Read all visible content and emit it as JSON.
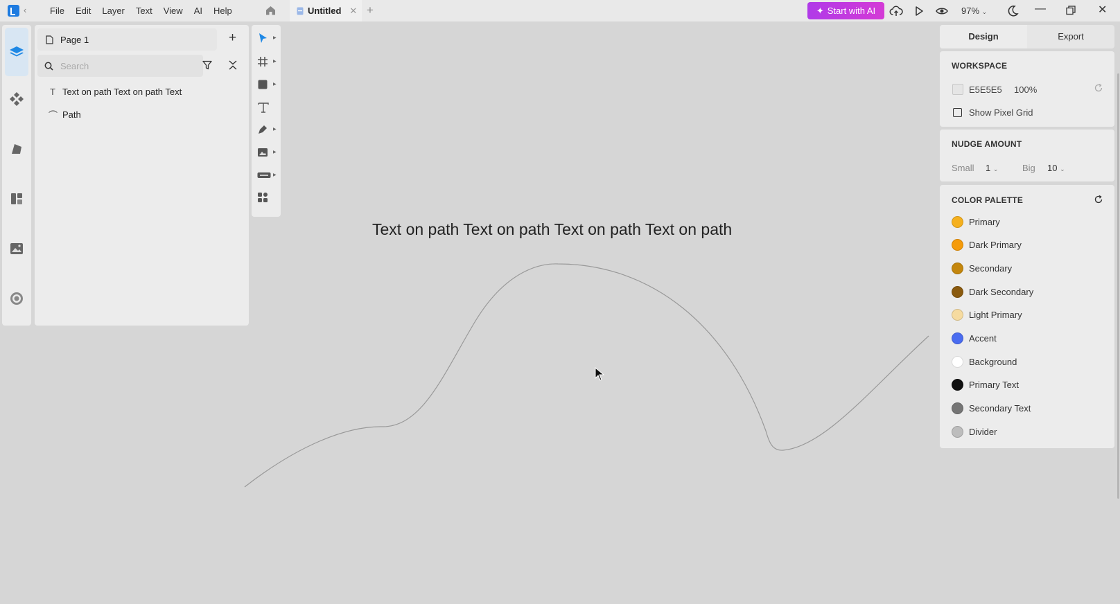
{
  "menu": {
    "items": [
      "File",
      "Edit",
      "Layer",
      "Text",
      "View",
      "AI",
      "Help"
    ]
  },
  "tab": {
    "title": "Untitled"
  },
  "toolbar": {
    "ai_button_label": "Start with AI",
    "zoom": "97%"
  },
  "layers": {
    "page_name": "Page 1",
    "search_placeholder": "Search",
    "items": [
      {
        "type": "text",
        "icon": "text-layer-icon",
        "label": "Text on path Text on path Text"
      },
      {
        "type": "path",
        "icon": "path-layer-icon",
        "label": "Path"
      }
    ]
  },
  "canvas": {
    "text": "Text on path Text on path Text on path Text on path"
  },
  "right_panel": {
    "tabs": [
      "Design",
      "Export"
    ],
    "workspace": {
      "title": "WORKSPACE",
      "color_hex": "E5E5E5",
      "color": "#E5E5E5",
      "opacity": "100%",
      "show_pixel_grid_label": "Show Pixel Grid",
      "show_pixel_grid": false
    },
    "nudge": {
      "title": "NUDGE AMOUNT",
      "small_label": "Small",
      "small_value": "1",
      "big_label": "Big",
      "big_value": "10"
    },
    "palette": {
      "title": "COLOR PALETTE",
      "colors": [
        {
          "name": "Primary",
          "color": "#F5B01E"
        },
        {
          "name": "Dark Primary",
          "color": "#F59B0A"
        },
        {
          "name": "Secondary",
          "color": "#C4860C"
        },
        {
          "name": "Dark Secondary",
          "color": "#8A5A0E"
        },
        {
          "name": "Light Primary",
          "color": "#F6DBA0"
        },
        {
          "name": "Accent",
          "color": "#4A6CF0"
        },
        {
          "name": "Background",
          "color": "#FFFFFF"
        },
        {
          "name": "Primary Text",
          "color": "#111111"
        },
        {
          "name": "Secondary Text",
          "color": "#757575"
        },
        {
          "name": "Divider",
          "color": "#BDBDBD"
        }
      ]
    }
  }
}
